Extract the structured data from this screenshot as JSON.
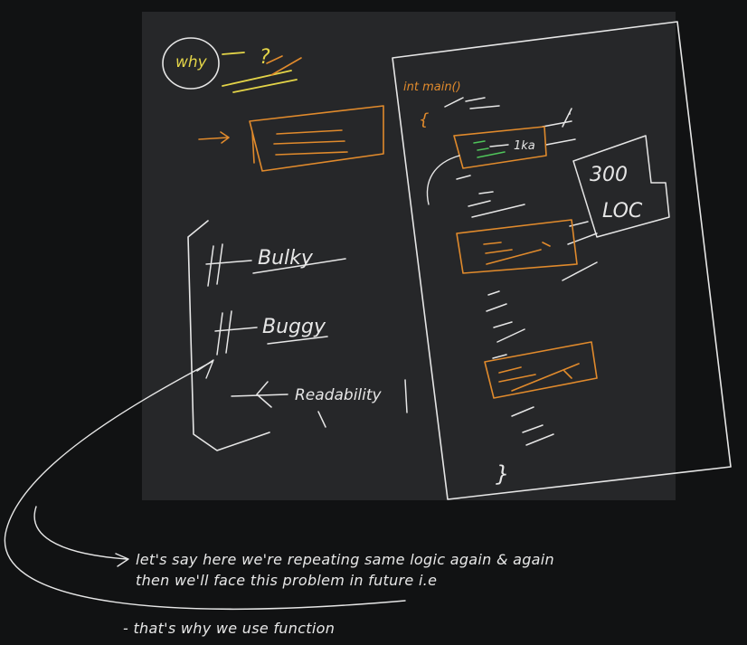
{
  "colors": {
    "background": "#111213",
    "board": "#262729",
    "ink_white": "#e6e6e6",
    "ink_orange": "#e08a2c",
    "ink_yellow": "#e3d448",
    "ink_green": "#4fc45a"
  },
  "left_notes": {
    "why": "why",
    "question": "?",
    "items": [
      "Bulky",
      "Buggy",
      "Readability"
    ]
  },
  "code_page": {
    "signature": "int main()",
    "open_brace": "{",
    "close_brace": "}",
    "block_label": "1ka",
    "loc_bubble_line1": "300",
    "loc_bubble_line2": "LOC"
  },
  "caption": {
    "line1": "let's say here we're repeating same logic again & again",
    "line2": "then we'll face this problem in future i.e",
    "line3": "- that's why we use function"
  }
}
